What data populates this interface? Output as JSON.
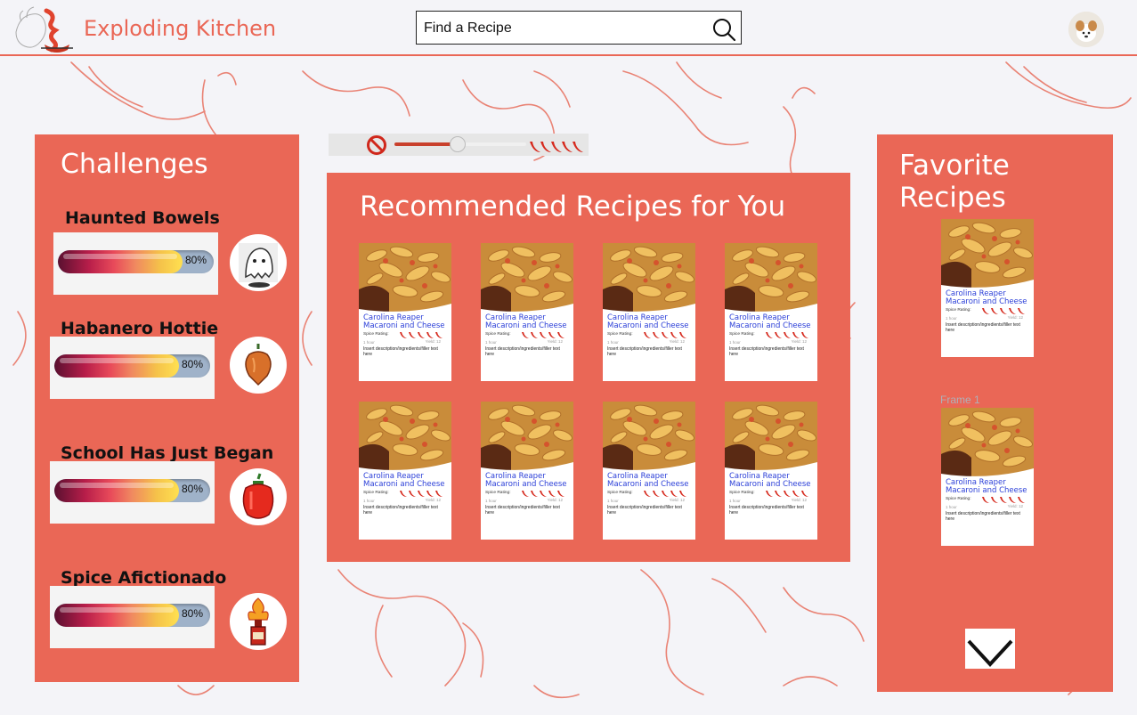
{
  "header": {
    "app_title": "Exploding Kitchen",
    "search_placeholder": "Find a Recipe",
    "search_value": ""
  },
  "colors": {
    "accent": "#ea6756",
    "card_title": "#2b3fd8",
    "pepper": "#d62a1e"
  },
  "challenges": {
    "title": "Challenges",
    "items": [
      {
        "name": "Haunted Bowels",
        "progress": 0.8,
        "progress_label": "80%",
        "badge_icon": "ghost-icon"
      },
      {
        "name": "Habanero Hottie",
        "progress": 0.8,
        "progress_label": "80%",
        "badge_icon": "habanero-icon"
      },
      {
        "name": "School Has Just Began",
        "progress": 0.8,
        "progress_label": "80%",
        "badge_icon": "bell-pepper-icon"
      },
      {
        "name": "Spice Afictionado",
        "progress": 0.8,
        "progress_label": "80%",
        "badge_icon": "hot-sauce-fire-icon"
      }
    ]
  },
  "spice_slider": {
    "value": 0.48,
    "min_icon": "no-spice-icon",
    "max_icon": "chili-peppers-icon"
  },
  "recommended": {
    "title": "Recommended Recipes for You",
    "cards": [
      {
        "title": "Carolina Reaper Macaroni and Cheese",
        "spice_label": "Spice Rating:",
        "time": "1 hour",
        "yield": "Yield: 12",
        "description": "Insert description/ingredients/filler text here"
      },
      {
        "title": "Carolina Reaper Macaroni and Cheese",
        "spice_label": "Spice Rating:",
        "time": "1 hour",
        "yield": "Yield: 12",
        "description": "Insert description/ingredients/filler text here"
      },
      {
        "title": "Carolina Reaper Macaroni and Cheese",
        "spice_label": "Spice Rating:",
        "time": "1 hour",
        "yield": "Yield: 12",
        "description": "Insert description/ingredients/filler text here"
      },
      {
        "title": "Carolina Reaper Macaroni and Cheese",
        "spice_label": "Spice Rating:",
        "time": "1 hour",
        "yield": "Yield: 12",
        "description": "Insert description/ingredients/filler text here"
      },
      {
        "title": "Carolina Reaper Macaroni and Cheese",
        "spice_label": "Spice Rating:",
        "time": "1 hour",
        "yield": "Yield: 12",
        "description": "Insert description/ingredients/filler text here"
      },
      {
        "title": "Carolina Reaper Macaroni and Cheese",
        "spice_label": "Spice Rating:",
        "time": "1 hour",
        "yield": "Yield: 12",
        "description": "Insert description/ingredients/filler text here"
      },
      {
        "title": "Carolina Reaper Macaroni and Cheese",
        "spice_label": "Spice Rating:",
        "time": "1 hour",
        "yield": "Yield: 12",
        "description": "Insert description/ingredients/filler text here"
      },
      {
        "title": "Carolina Reaper Macaroni and Cheese",
        "spice_label": "Spice Rating:",
        "time": "1 hour",
        "yield": "Yield: 12",
        "description": "Insert description/ingredients/filler text here"
      }
    ]
  },
  "favorites": {
    "title": "Favorite Recipes",
    "frame_label": "Frame 1",
    "cards": [
      {
        "title": "Carolina Reaper Macaroni and Cheese",
        "spice_label": "Spice Rating:",
        "time": "1 hour",
        "yield": "Yield: 12",
        "description": "Insert description/ingredients/filler text here"
      },
      {
        "title": "Carolina Reaper Macaroni and Cheese",
        "spice_label": "Spice Rating:",
        "time": "1 hour",
        "yield": "Yield: 12",
        "description": "Insert description/ingredients/filler text here"
      }
    ],
    "more_icon": "chevron-down-icon"
  }
}
